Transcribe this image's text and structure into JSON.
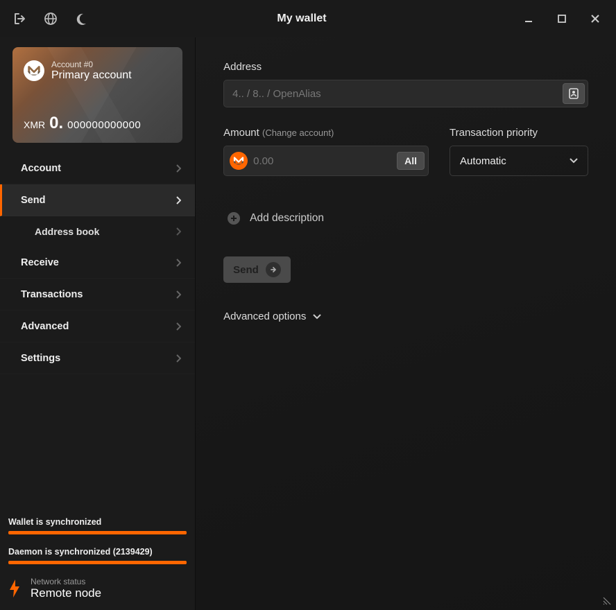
{
  "titlebar": {
    "title": "My wallet"
  },
  "account": {
    "number": "Account #0",
    "name": "Primary account",
    "currency": "XMR",
    "balance_int": "0.",
    "balance_dec": "000000000000"
  },
  "nav": {
    "account": "Account",
    "send": "Send",
    "address_book": "Address book",
    "receive": "Receive",
    "transactions": "Transactions",
    "advanced": "Advanced",
    "settings": "Settings"
  },
  "sync": {
    "wallet": "Wallet is synchronized",
    "daemon": "Daemon is synchronized (2139429)"
  },
  "network": {
    "label": "Network status",
    "value": "Remote node"
  },
  "send": {
    "address_label": "Address",
    "address_placeholder": "4.. / 8.. / OpenAlias",
    "amount_label": "Amount",
    "change_account": "(Change account)",
    "amount_placeholder": "0.00",
    "all_btn": "All",
    "priority_label": "Transaction priority",
    "priority_value": "Automatic",
    "add_description": "Add description",
    "send_btn": "Send",
    "advanced_options": "Advanced options"
  }
}
